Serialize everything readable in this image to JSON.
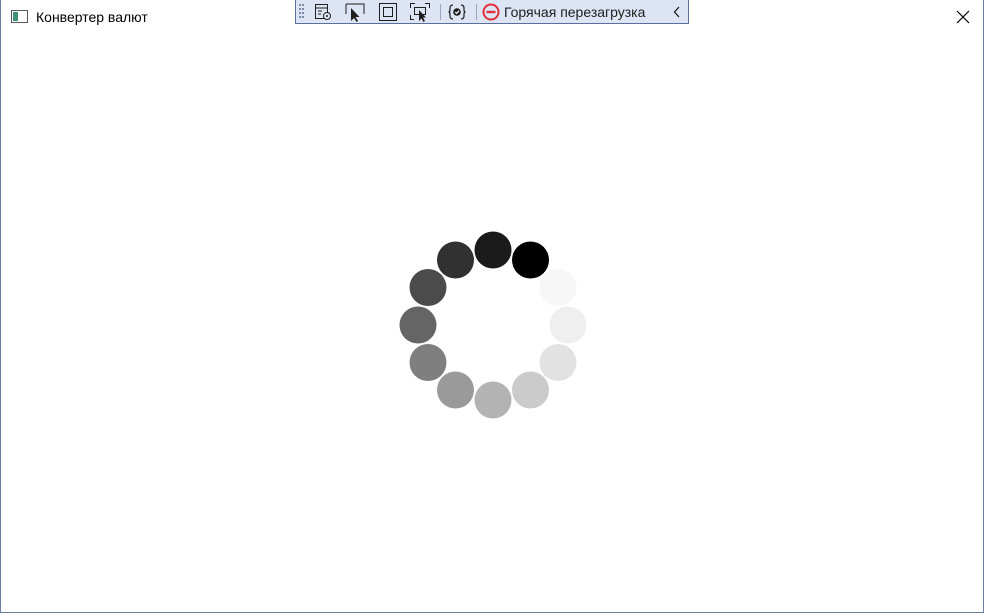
{
  "window": {
    "title": "Конвертер валют",
    "app_icon": "window-app-icon",
    "close_icon": "close-icon"
  },
  "dev_toolbar": {
    "buttons": [
      {
        "name": "live-visual-tree-icon"
      },
      {
        "name": "select-element-icon"
      },
      {
        "name": "display-layout-adorners-icon"
      },
      {
        "name": "track-focused-element-icon"
      },
      {
        "name": "binding-failures-icon"
      }
    ],
    "hot_reload": {
      "label": "Горячая перезагрузка",
      "icon": "no-entry-icon",
      "status_color": "#e0303a"
    },
    "collapse_icon": "chevron-left-icon",
    "background": "#dde4f3"
  },
  "loading_indicator": {
    "dots": 12,
    "colors": [
      "#000000",
      "#f7f7f7",
      "#efefef",
      "#e2e2e2",
      "#cbcbcb",
      "#b3b3b3",
      "#9a9a9a",
      "#7f7f7f",
      "#656565",
      "#4b4b4b",
      "#313131",
      "#1b1b1b"
    ]
  }
}
